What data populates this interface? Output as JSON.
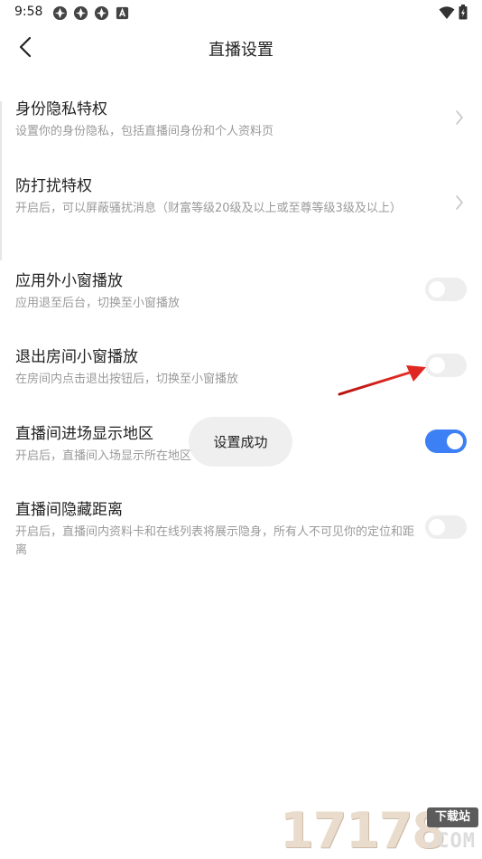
{
  "status_bar": {
    "time": "9:58",
    "notification_icons": [
      "app-icon",
      "app-icon",
      "app-icon",
      "a-icon"
    ],
    "right_icons": [
      "wifi-icon",
      "battery-icon"
    ]
  },
  "header": {
    "title": "直播设置",
    "back_icon": "chevron-left-icon"
  },
  "settings": [
    {
      "title": "身份隐私特权",
      "desc": "设置你的身份隐私，包括直播间身份和个人资料页",
      "control": "chevron"
    },
    {
      "title": "防打扰特权",
      "desc": "开启后，可以屏蔽骚扰消息（财富等级20级及以上或至尊等级3级及以上）",
      "control": "chevron"
    },
    {
      "title": "应用外小窗播放",
      "desc": "应用退至后台，切换至小窗播放",
      "control": "toggle",
      "enabled": false
    },
    {
      "title": "退出房间小窗播放",
      "desc": "在房间内点击退出按钮后，切换至小窗播放",
      "control": "toggle",
      "enabled": false
    },
    {
      "title": "直播间进场显示地区",
      "desc": "开启后，直播间入场显示所在地区",
      "control": "toggle",
      "enabled": true
    },
    {
      "title": "直播间隐藏距离",
      "desc": "开启后，直播间内资料卡和在线列表将展示隐身，所有人不可见你的定位和距离",
      "control": "toggle",
      "enabled": false
    }
  ],
  "toast": {
    "text": "设置成功"
  },
  "watermark": {
    "digits": "17178",
    "badge": "下载站",
    "domain": ".COM"
  },
  "colors": {
    "toggle_on": "#3d7ff5",
    "toggle_off": "#eeeeee",
    "desc_text": "#9a9a9a",
    "arrow": "#d9201c"
  }
}
